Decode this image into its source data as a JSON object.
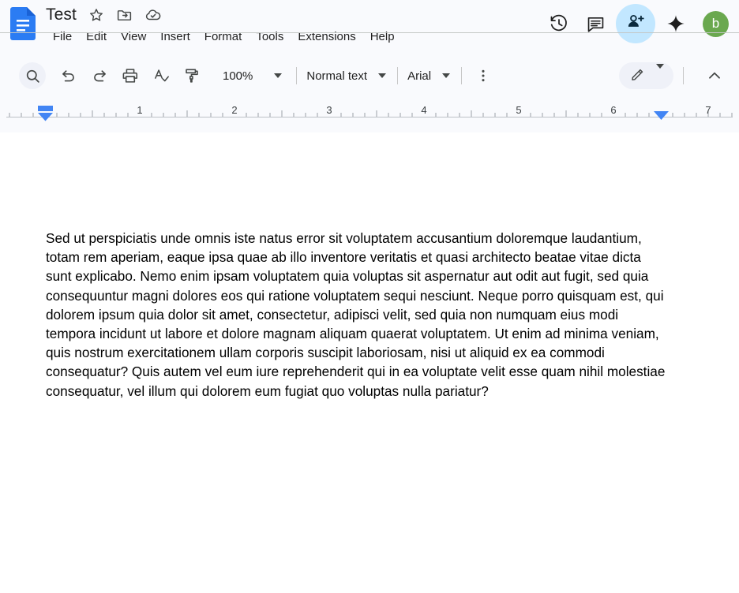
{
  "app": {
    "logo_icon": "google-docs-logo-icon",
    "document_title": "Test",
    "title_icons": [
      {
        "name": "star-icon",
        "label": "Star"
      },
      {
        "name": "move-to-folder-icon",
        "label": "Move"
      },
      {
        "name": "cloud-saved-icon",
        "label": "Saved to Drive"
      }
    ]
  },
  "menubar": {
    "items": [
      {
        "id": "file",
        "label": "File"
      },
      {
        "id": "edit",
        "label": "Edit"
      },
      {
        "id": "view",
        "label": "View"
      },
      {
        "id": "insert",
        "label": "Insert"
      },
      {
        "id": "format",
        "label": "Format"
      },
      {
        "id": "tools",
        "label": "Tools"
      },
      {
        "id": "extensions",
        "label": "Extensions"
      },
      {
        "id": "help",
        "label": "Help"
      }
    ]
  },
  "header_actions": {
    "history_icon": "version-history-icon",
    "comments_icon": "comment-icon",
    "share_icon": "share-person-add-icon",
    "gemini_icon": "gemini-sparkle-icon",
    "avatar_letter": "b",
    "avatar_color": "#6aa84f",
    "share_bg_color": "#c2e7ff"
  },
  "toolbar": {
    "search_icon": "search-icon",
    "undo_icon": "undo-icon",
    "redo_icon": "redo-icon",
    "print_icon": "print-icon",
    "spellcheck_icon": "spellcheck-icon",
    "paint_format_icon": "paint-format-icon",
    "zoom_value": "100%",
    "style_value": "Normal text",
    "font_value": "Arial",
    "more_options_icon": "more-vertical-icon",
    "edit_mode_icon": "pencil-edit-icon",
    "collapse_icon": "chevron-up-icon"
  },
  "ruler": {
    "tick_labels": [
      "1",
      "2",
      "3",
      "4",
      "5",
      "6",
      "7"
    ],
    "left_indent_marker": "left-indent-marker",
    "right_indent_marker": "right-indent-marker",
    "marker_color": "#4285f4"
  },
  "document": {
    "paragraph": "Sed ut perspiciatis unde omnis iste natus error sit voluptatem accusantium doloremque laudantium, totam rem aperiam, eaque ipsa quae ab illo inventore veritatis et quasi architecto beatae vitae dicta sunt explicabo. Nemo enim ipsam voluptatem quia voluptas sit aspernatur aut odit aut fugit, sed quia consequuntur magni dolores eos qui ratione voluptatem sequi nesciunt. Neque porro quisquam est, qui dolorem ipsum quia dolor sit amet, consectetur, adipisci velit, sed quia non numquam eius modi tempora incidunt ut labore et dolore magnam aliquam quaerat voluptatem. Ut enim ad minima veniam, quis nostrum exercitationem ullam corporis suscipit laboriosam, nisi ut aliquid ex ea commodi consequatur? Quis autem vel eum iure reprehenderit qui in ea voluptate velit esse quam nihil molestiae consequatur, vel illum qui dolorem eum fugiat quo voluptas nulla pariatur?"
  }
}
